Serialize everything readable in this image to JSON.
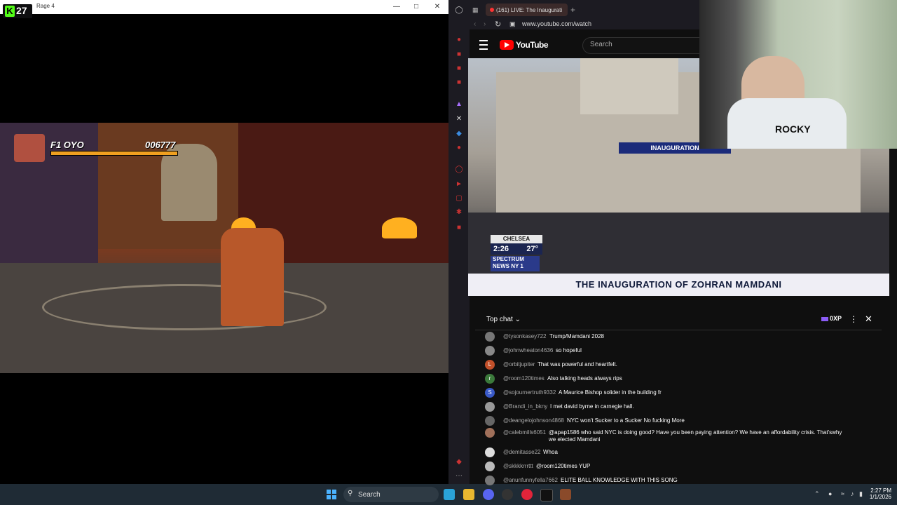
{
  "game_window": {
    "title": "Rage 4",
    "kick_viewers": "27",
    "hud": {
      "player": "F1 OYO",
      "score": "006777"
    }
  },
  "browser": {
    "tab_label": "(161) LIVE: The Inaugurati",
    "url": "www.youtube.com/watch",
    "yt_logo": "YouTube",
    "search_placeholder": "Search"
  },
  "video": {
    "location": "CHELSEA",
    "time": "2:26",
    "temp": "27°",
    "network": "SPECTRUM NEWS NY 1",
    "lower_third": "THE INAUGURATION OF ZOHRAN MAMDANI"
  },
  "chat": {
    "title": "Top chat",
    "points": "0XP",
    "messages": [
      {
        "user": "@tysonkasey722",
        "text": "Trump/Mamdani 2028",
        "avatar": "",
        "color": "#777"
      },
      {
        "user": "@johnwheaton4636",
        "text": "so hopeful",
        "avatar": "",
        "color": "#888"
      },
      {
        "user": "@orbitjupiter",
        "text": "That was powerful and heartfelt.",
        "avatar": "L",
        "color": "#c2502a"
      },
      {
        "user": "@room120times",
        "text": "Also talking heads always rips",
        "avatar": "r",
        "color": "#3b7a3b"
      },
      {
        "user": "@sojournertruth9332",
        "text": "A Maurice Bishop solider in the building fr",
        "avatar": "S",
        "color": "#3a5ac8"
      },
      {
        "user": "@Brandi_in_bkny",
        "text": "I met david byrne in carnegie hall.",
        "avatar": "",
        "color": "#999"
      },
      {
        "user": "@deangelojohnson4868",
        "text": "NYC won't Sucker to a Sucker No fucking More",
        "avatar": "",
        "color": "#666"
      },
      {
        "user": "@calebmills6051",
        "text": "@apap1586 who said NYC is doing good? Have you been paying attention? We have an affordability crisis. That'swhy we elected Mamdani",
        "avatar": "",
        "color": "#a0705a"
      },
      {
        "user": "@demitasse22",
        "text": "Whoa",
        "avatar": "",
        "color": "#ddd"
      },
      {
        "user": "@skkkkrrrttt",
        "text": "@room120times YUP",
        "avatar": "",
        "color": "#bbb"
      },
      {
        "user": "@anunfunnyfella7662",
        "text": "ELITE BALL KNOWLEDGE WITH THIS SONG",
        "avatar": "",
        "color": "#777"
      }
    ]
  },
  "taskbar": {
    "search_label": "Search",
    "time": "2:27 PM",
    "date": "1/1/2026"
  }
}
